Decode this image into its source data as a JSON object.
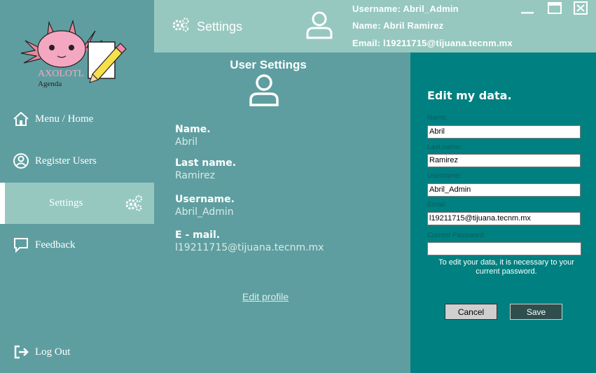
{
  "app": {
    "logo_text": "AXOLOTL",
    "logo_sub": "Agenda"
  },
  "sidebar": {
    "items": [
      {
        "label": "Menu / Home",
        "icon": "home-icon"
      },
      {
        "label": "Register Users",
        "icon": "user-circle-icon"
      },
      {
        "label": "Settings",
        "icon": "gears-icon"
      },
      {
        "label": "Feedback",
        "icon": "chat-bubble-icon"
      },
      {
        "label": "Log Out",
        "icon": "logout-icon"
      }
    ]
  },
  "topbar": {
    "title": "Settings",
    "username_line": "Username: Abril_Admin",
    "name_line": "Name: Abril  Ramirez",
    "email_line": "Email: l19211715@tijuana.tecnm.mx"
  },
  "main": {
    "title": "User Settings",
    "fields": [
      {
        "label": "Name.",
        "value": "Abril"
      },
      {
        "label": "Last name.",
        "value": "Ramirez"
      },
      {
        "label": "Username.",
        "value": "Abril_Admin"
      },
      {
        "label": "E - mail.",
        "value": "l19211715@tijuana.tecnm.mx"
      }
    ],
    "edit_link": "Edit profile"
  },
  "edit": {
    "title": "Edit my data.",
    "inputs": [
      {
        "label": "Name:",
        "value": "Abril"
      },
      {
        "label": "Last name:",
        "value": "Ramirez"
      },
      {
        "label": "Username:",
        "value": "Abril_Admin"
      },
      {
        "label": "Email:",
        "value": "l19211715@tijuana.tecnm.mx"
      },
      {
        "label": "Current Password:",
        "value": ""
      }
    ],
    "note": "To edit your data, it is necessary to your current password.",
    "cancel_label": "Cancel",
    "save_label": "Save"
  },
  "colors": {
    "sidebar_bg": "#5f9ea0",
    "topbar_bg": "#96c8bf",
    "panel_bg": "#008080"
  }
}
